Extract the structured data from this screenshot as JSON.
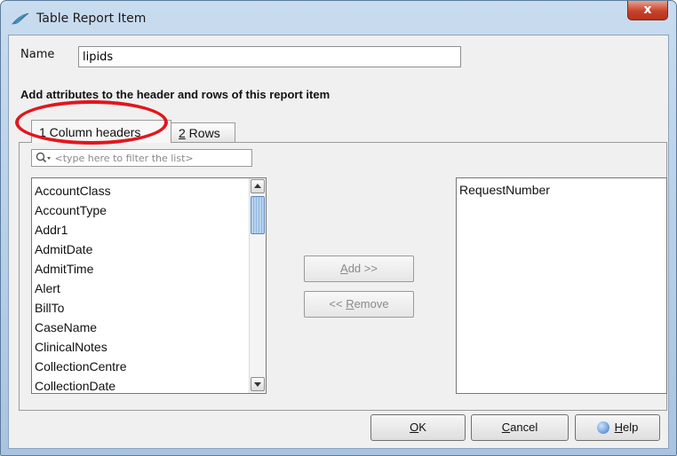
{
  "window": {
    "title": "Table Report Item",
    "close_label": "x"
  },
  "form": {
    "name_label": "Name",
    "name_value": "lipids"
  },
  "section_heading": "Add attributes to the header and rows of this report item",
  "tabs": [
    {
      "label": "1 Column headers",
      "mnemonic": "1",
      "rest": " Column headers",
      "active": true
    },
    {
      "label": "2 Rows",
      "mnemonic": "2",
      "rest": " Rows",
      "active": false
    }
  ],
  "filter": {
    "placeholder": "<type here to filter the list>"
  },
  "available_attributes": [
    "AccountClass",
    "AccountType",
    "Addr1",
    "AdmitDate",
    "AdmitTime",
    "Alert",
    "BillTo",
    "CaseName",
    "ClinicalNotes",
    "CollectionCentre",
    "CollectionDate"
  ],
  "selected_attributes": [
    "RequestNumber"
  ],
  "buttons": {
    "add": {
      "label": "Add >>",
      "mnemonic": "A",
      "rest": "dd >>"
    },
    "remove": {
      "label": "<< Remove",
      "prefix": "<< ",
      "mnemonic": "R",
      "rest": "emove"
    },
    "ok": {
      "label": "OK",
      "mnemonic": "O",
      "rest": "K"
    },
    "cancel": {
      "label": "Cancel",
      "mnemonic": "C",
      "rest": "ancel"
    },
    "help": {
      "label": "Help",
      "mnemonic": "H",
      "rest": "elp"
    }
  },
  "colors": {
    "annotation": "#e2161d",
    "titlebar": "#b9d1ea",
    "close_button": "#c7422a"
  },
  "icons": {
    "app": "feather-icon",
    "search": "search-icon",
    "help": "help-icon"
  }
}
